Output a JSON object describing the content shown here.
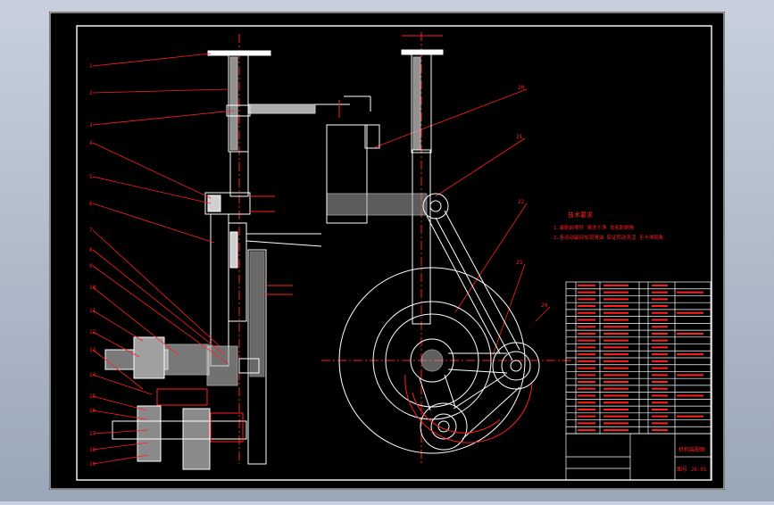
{
  "balloons": [
    "1",
    "2",
    "3",
    "4",
    "5",
    "6",
    "7",
    "8",
    "9",
    "10",
    "11",
    "12",
    "13",
    "14",
    "15",
    "16",
    "17",
    "18",
    "19",
    "20",
    "21",
    "22",
    "23",
    "24"
  ],
  "tech_notes": {
    "title": "技术要求",
    "lines": [
      "1.装配前零件 清洗干净 去毛刺倒角",
      "2.各运动副间加润滑油 保证转动灵活 无卡滞现象"
    ]
  },
  "title_block": {
    "name": "机构装配图",
    "drawing_no": "图号 JX-01"
  },
  "colors": {
    "background": "#000000",
    "frame": "#ffffff",
    "geometry": "#ffffff",
    "annotation": "#ff2020",
    "centerline": "#ff2020",
    "dimension": "#ff2020"
  }
}
